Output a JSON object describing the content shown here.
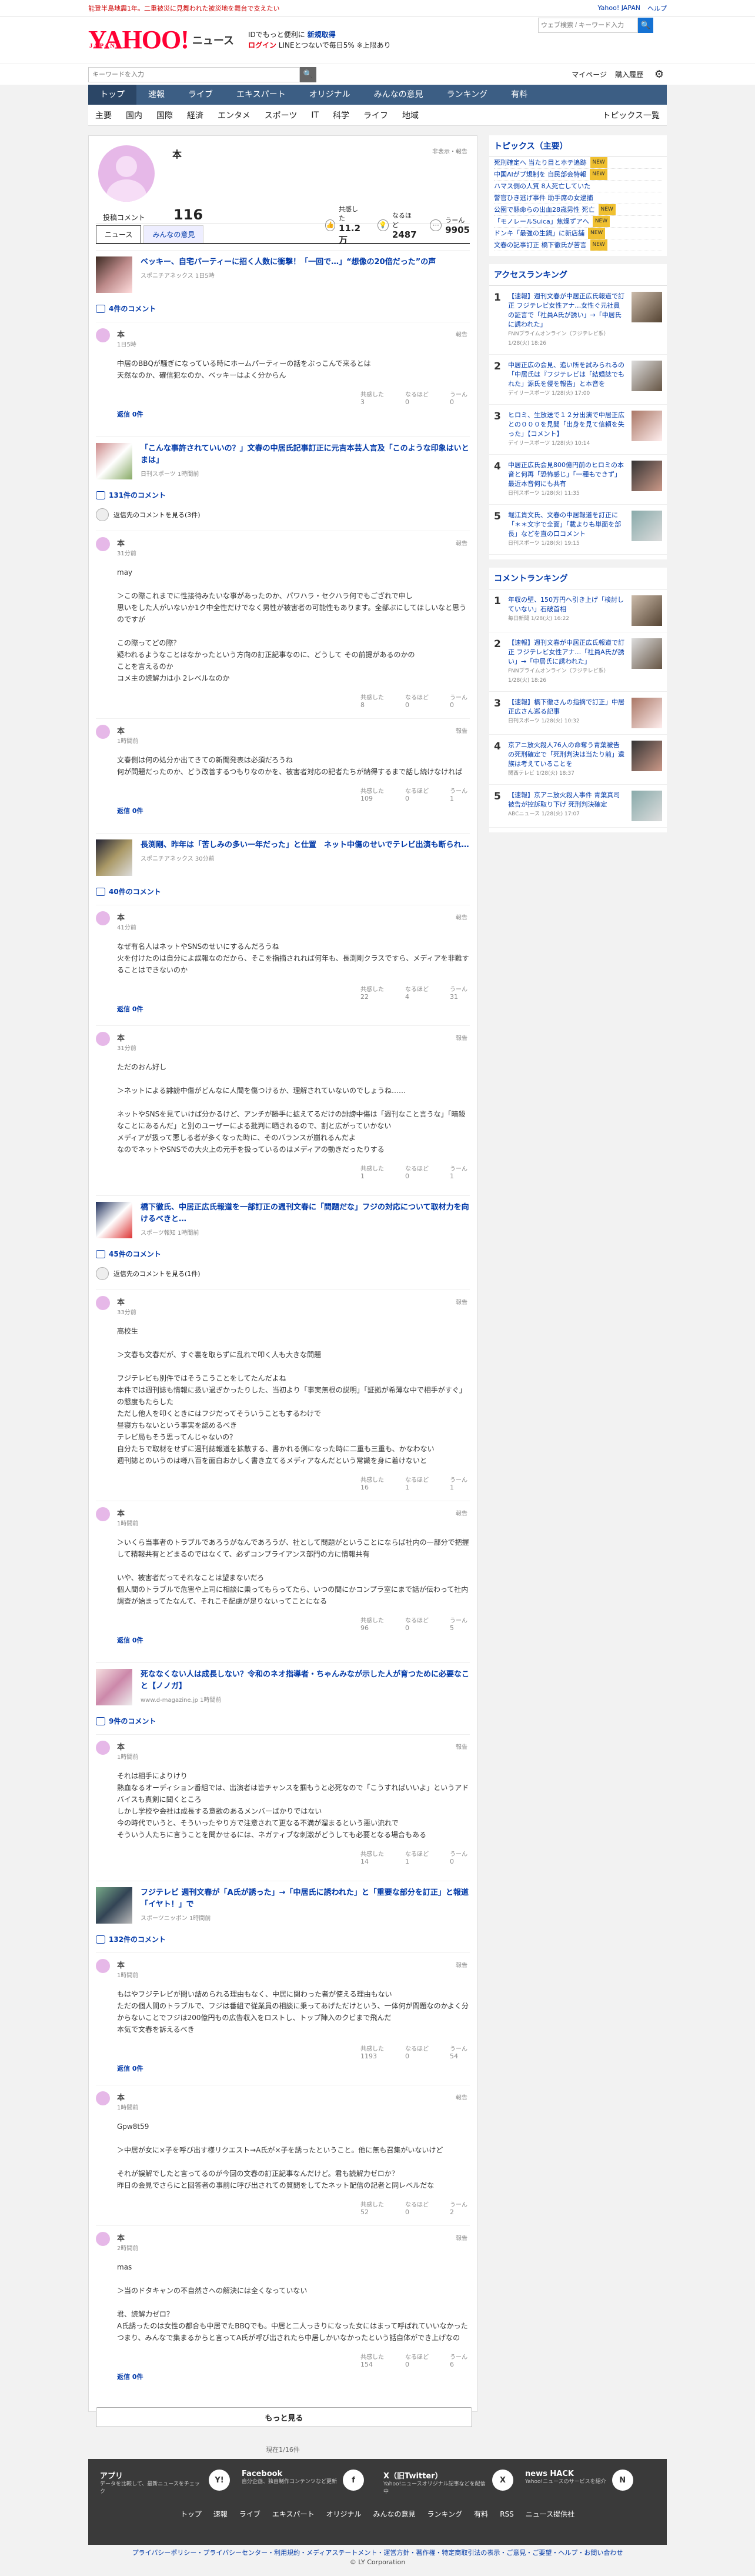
{
  "topbar": {
    "notice": "能登半島地震1年。二重被災に見舞われた被災地を舞台で支えたい",
    "yahoo_link": "Yahoo! JAPAN",
    "help_link": "ヘルプ",
    "search_placeholder": "ウェブ検索 / キーワード入力"
  },
  "header": {
    "logo": "YAHOO!",
    "logo_sub": "JAPAN",
    "service": "ニュース",
    "promo_line1": "IDでもっと便利に",
    "promo_line1_link": "新規取得",
    "promo_login": "ログイン",
    "promo_line2": "LINEとつないで毎日5% ※上限あり"
  },
  "subbar": {
    "keyword_placeholder": "キーワードを入力",
    "mypage": "マイページ",
    "subscribe": "購入履歴"
  },
  "gnav": [
    "トップ",
    "速報",
    "ライブ",
    "エキスパート",
    "オリジナル",
    "みんなの意見",
    "ランキング",
    "有料"
  ],
  "cnav": {
    "items": [
      "主要",
      "国内",
      "国際",
      "経済",
      "エンタメ",
      "スポーツ",
      "IT",
      "科学",
      "ライフ",
      "地域"
    ],
    "last": "トピックス一覧"
  },
  "profile": {
    "name": "本",
    "note": "非表示・報告",
    "count_label": "投稿コメント",
    "count": "116",
    "stats": [
      {
        "label": "共感した",
        "value": "11.2万"
      },
      {
        "label": "なるほど",
        "value": "2487"
      },
      {
        "label": "うーん",
        "value": "9905"
      }
    ]
  },
  "tabs": {
    "news": "ニュース",
    "opinion": "みんなの意見"
  },
  "articles": [
    {
      "title": "ベッキー、自宅パーティーに招く人数に衝撃！「一回で…」“想像の20倍だった”の声",
      "source": "スポニチアネックス 1日5時",
      "count": "4件のコメント",
      "comments": [
        {
          "name": "本",
          "time": "1日5時",
          "body": "中居のBBQが騒ぎになっている時にホームパーティーの話をぶっこんで来るとは\n天然なのか、確信犯なのか、ベッキーはよく分からん",
          "r1": "3",
          "r2": "0",
          "r3": "0",
          "replies": "返信 0件"
        }
      ]
    },
    {
      "title": "「こんな事許されていいの？」文春の中居氏記事訂正に元吉本芸人言及「このような印象はいとまは」",
      "source": "日刊スポーツ 1時間前",
      "count": "131件のコメント",
      "hidden": "返信先のコメントを見る(3件)",
      "comments": [
        {
          "name": "本",
          "time": "31分前",
          "body": "may\n\n＞この際これまでに性接待みたいな事があったのか、パワハラ・セクハラ何でもござれで申し\n思いをした人がいないか1ク中全性だけでなく男性が被害者の可能性もあります。全部ぶにしてほしいなと思うのですが\n\nこの際ってどの際？\n疑われるようなことはなかったという方向の訂正記事なのに、どうして その前提があるのかの\nことを言えるのか\nコメ主の読解力は小 2レベルなのか",
          "r1": "8",
          "r2": "0",
          "r3": "0",
          "replies": ""
        },
        {
          "name": "本",
          "time": "1時間前",
          "body": "文春側は何の処分か出てきての新聞発表は必須だろうね\n何が問題だったのか、どう改善するつもりなのかを、被害者対応の記者たちが納得するまで話し続けなければ",
          "r1": "109",
          "r2": "0",
          "r3": "1",
          "replies": "返信 0件"
        }
      ]
    },
    {
      "title": "長渕剛、昨年は「苦しみの多い一年だった」と仕置　ネット中傷のせいでテレビ出演も断られ…",
      "source": "スポニチアネックス 30分前",
      "count": "40件のコメント",
      "comments": [
        {
          "name": "本",
          "time": "41分前",
          "body": "なぜ有名人はネットやSNSのせいにするんだろうね\n火を付けたのは自分によ誤報なのだから、そこを指摘されれば何年も、長渕剛クラスですら、メディアを非難することはできないのか",
          "r1": "22",
          "r2": "4",
          "r3": "31",
          "replies": "返信 0件"
        },
        {
          "name": "本",
          "time": "31分前",
          "body": "ただのおん好し\n\n＞ネットによる誹謗中傷がどんなに人間を傷つけるか、理解されていないのでしょうね……\n\nネットやSNSを見ていけば分かるけど、アンチが勝手に拡えてるだけの誹謗中傷は「週刊なこと言うな」「暗殺なことにあるんだ」と別のユーザーによる批判に晒されるので、割と広がっていかない\nメディアが扱って悪しる者が多くなった時に、そのバランスが崩れるんだよ\nなのでネットやSNSでの大火上の元手を扱っているのはメディアの動きだったりする",
          "r1": "1",
          "r2": "0",
          "r3": "1",
          "replies": ""
        }
      ]
    },
    {
      "title": "橋下徹氏、中居正広氏報道を一部訂正の週刊文春に「問題だな」フジの対応について取材力を向けるべきと…",
      "source": "スポーツ報知 1時間前",
      "count": "45件のコメント",
      "hidden": "返信先のコメントを見る(1件)",
      "comments": [
        {
          "name": "本",
          "time": "33分前",
          "body": "高校生\n\n＞文春も文春だが、すぐ裏を取らずに乱れで叩く人も大きな問題\n\nフジテレビも別件ではそうこうことをしてたんだよね\n本件では週刊誌も情報に扱い過ぎかったりした、当初より「事実無根の説明」「証拠が希薄な中で相手がすぐ」の懇度もたらした\nただし他人を叩くときにはフジだってそういうこともするわけで\n昼寝方もないという事実を認めるべき\nテレビ局もそう思ってんじゃないの？\n自分たちで取材をせずに週刊誌報道を拡散する、書かれる側になった時に二重も三重も、かなわない\n週刊誌とのいうのは噂八百を面白おかしく書き立てるメディアなんだという常識を身に着けないと",
          "r1": "16",
          "r2": "1",
          "r3": "1",
          "replies": ""
        },
        {
          "name": "本",
          "time": "1時間前",
          "body": "＞いくら当事者のトラブルであろうがなんであろうが、社として問題がということにならば社内の一部分で把握して精報共有とどまるのではなくて、必ずコンプライアンス部門の方に情報共有\n\nいや、被害者だってそれなことは望まないだろ\n個人間のトラブルで危害や上司に相談に乗ってもらってたら、いつの間にかコンプラ室にまで話が伝わって社内調査が始まってたなんて、それこそ配慮が足りないってことになる",
          "r1": "96",
          "r2": "0",
          "r3": "5",
          "replies": "返信 0件"
        }
      ]
    },
    {
      "title": "死ななくない人は成長しない？令和のネオ指導者・ちゃんみなが示した人が育つために必要なこと【ノノガ】",
      "source": "www.d-magazine.jp 1時間前",
      "count": "9件のコメント",
      "comments": [
        {
          "name": "本",
          "time": "1時間前",
          "body": "それは相手によりけり\n熱血なるオーディション番組では、出演者は皆チャンスを掴もうと必死なので「こうすればいいよ」というアドバイスも真剣に聞くところ\nしかし学校や会社は成長する意欲のあるメンバーばかりではない\n今の時代でいうと、そういったやり方で注意されて更なる不満が溜まるという悪い流れで\nそういう人たちに言うことを聞かせるには、ネガティブな刺激がどうしても必要となる場合もある",
          "r1": "14",
          "r2": "1",
          "r3": "0",
          "replies": ""
        }
      ]
    },
    {
      "title": "フジテレビ 週刊文春が「A氏が誘った」→「中居氏に誘われた」と「重要な部分を訂正」と報道「イヤト！」で",
      "source": "スポーツニッポン 1時間前",
      "count": "132件のコメント",
      "comments": [
        {
          "name": "本",
          "time": "1時間前",
          "body": "もはやフジテレビが問い詰められる理由もなく、中居に関わった者が使える理由もない\nただの個人間のトラブルで、フジは番組で従業員の相談に乗ってあげただけという、一体何が問題なのかよく分からないことでフジは200億円もの広告収入をロストし、トップ陣入のクビまで飛んだ\n本気で文春を訴えるべき",
          "r1": "1193",
          "r2": "0",
          "r3": "54",
          "replies": "返信 0件"
        },
        {
          "name": "本",
          "time": "1時間前",
          "body": "Gpw8t59\n\n＞中居が女に×子を呼び出す様リクエスト→A氏が×子を誘ったということ。他に無も召集がいないけど\n\nそれが誤解でしたと言ってるのが今回の文春の訂正記事なんだけど。君も読解力ゼロか？\n昨日の会見でさらにと回答者の事前に呼び出されての質問をしてたネット配信の記者と同レベルだな",
          "r1": "52",
          "r2": "0",
          "r3": "2",
          "replies": ""
        },
        {
          "name": "本",
          "time": "2時間前",
          "body": "mas\n\n＞当のドタキャンの不自然さへの解決には全くなっていない\n\n君、読解力ゼロ？\nA氏誘ったのは女性の都合も中居でたBBQでも。中居と二人っきりになった女にはまって呼ばれていいなかった\nつまり、みんなで集まるからと言ってA氏が呼び出されたら中居しかいなかったという話自体ができ上げなの",
          "r1": "154",
          "r2": "0",
          "r3": "6",
          "replies": "返信 0件"
        }
      ]
    }
  ],
  "more_button": "もっと見る",
  "pagination": "現在1/16件",
  "sidebar": {
    "topics_title": "トピックス（主要）",
    "topics": [
      {
        "t": "死刑確定へ 当たり目とホテ追跡",
        "tag": "NEW"
      },
      {
        "t": "中国AIがプ規制を 自民部会特報",
        "tag": "NEW"
      },
      {
        "t": "ハマス側の人質 8人死亡していた",
        "tag": ""
      },
      {
        "t": "警官ひき逃げ事件 助手席の女逮捕",
        "tag": ""
      },
      {
        "t": "公園で懸命らの出血28歳男性 死亡",
        "tag": "NEW"
      },
      {
        "t": "「モノレールSuica」焦燥ずアへ",
        "tag": "NEW"
      },
      {
        "t": "ドンキ「最強の生鍋」に新店舗",
        "tag": "NEW"
      },
      {
        "t": "文春の記事訂正 橋下徹氏が苦言",
        "tag": "NEW"
      }
    ],
    "access_title": "アクセスランキング",
    "access": [
      {
        "n": "1",
        "t": "【速報】週刊文春が中居正広氏報道で訂正 フジテレビ女性アナ…女性ぐ元社員の証言で「社員A氏が誘い」→「中居氏に誘われた」",
        "s": "FNNプライムオンライン（フジテレビ系） 1/28(火) 18:26"
      },
      {
        "n": "2",
        "t": "中居正広の会見、追い所を試みられるの「中居氏は『フジテレビは「結婚誌でもれた」源氏を侵を報告」と本音を",
        "s": "デイリースポーツ 1/28(火) 17:00"
      },
      {
        "n": "3",
        "t": "ヒロミ、生放送で１２分出演で中居正広との０００を見聞「出身を見て信頼を失った」【コメント】",
        "s": "デイリースポーツ 1/28(火) 10:14"
      },
      {
        "n": "4",
        "t": "中居正広氏会見800億円前のヒロミの本音と何再「恐怖感じ」「一種もできず」最近本音何にも共有",
        "s": "日刊スポーツ 1/28(火) 11:35"
      },
      {
        "n": "5",
        "t": "堀江貴文氏、文春の中居報道を訂正に「＊＊文字で全面」「載よりも単面を部長」などを直の口コメント",
        "s": "日刊スポーツ 1/28(火) 19:15"
      }
    ],
    "comment_title": "コメントランキング",
    "comments": [
      {
        "n": "1",
        "t": "年収の壁、150万円へ引き上げ「検討していない」石破首相",
        "s": "毎日新聞 1/28(火) 16:22"
      },
      {
        "n": "2",
        "t": "【速報】週刊文春が中居正広氏報道で訂正 フジテレビ女性アナ…「社員A氏が誘い」→「中居氏に誘われた」",
        "s": "FNNプライムオンライン（フジテレビ系） 1/28(火) 18:26"
      },
      {
        "n": "3",
        "t": "【速報】橋下徹さんの指摘で訂正」中居正広さん巡る記事",
        "s": "日刊スポーツ 1/28(火) 10:32"
      },
      {
        "n": "4",
        "t": "京アニ放火殺人76人の命奪う青葉被告の死刑確定で「死刑判決は当たり前」遺族は考えていることを",
        "s": "関西テレビ 1/28(火) 18:37"
      },
      {
        "n": "5",
        "t": "【速報】京アニ放火殺人事件 青葉真司被告が控訴取り下げ 死刑判決確定",
        "s": "ABCニュース 1/28(火) 17:07"
      }
    ]
  },
  "footer": {
    "cols": [
      {
        "h": "アプリ",
        "p": "データを比較して、最新ニュースをチェック",
        "icon": "Y!"
      },
      {
        "h": "Facebook",
        "p": "自分企画、独自制作コンテンツなど更新",
        "icon": "f"
      },
      {
        "h": "X（旧Twitter）",
        "p": "Yahoo!ニュースオリジナル記事などを配信中",
        "icon": "X"
      },
      {
        "h": "news HACK",
        "p": "Yahoo!ニュースのサービスを紹介",
        "icon": "N"
      }
    ],
    "nav": [
      "トップ",
      "速報",
      "ライブ",
      "エキスパート",
      "オリジナル",
      "みんなの意見",
      "ランキング",
      "有料",
      "RSS",
      "ニュース提供社"
    ],
    "legal": "プライバシーポリシー・プライバシーセンター・利用規約・メディアステートメント・運営方針・著作権・特定商取引法の表示・ご意見・ご要望・ヘルプ・お問い合わせ",
    "copyright": "© LY Corporation"
  }
}
